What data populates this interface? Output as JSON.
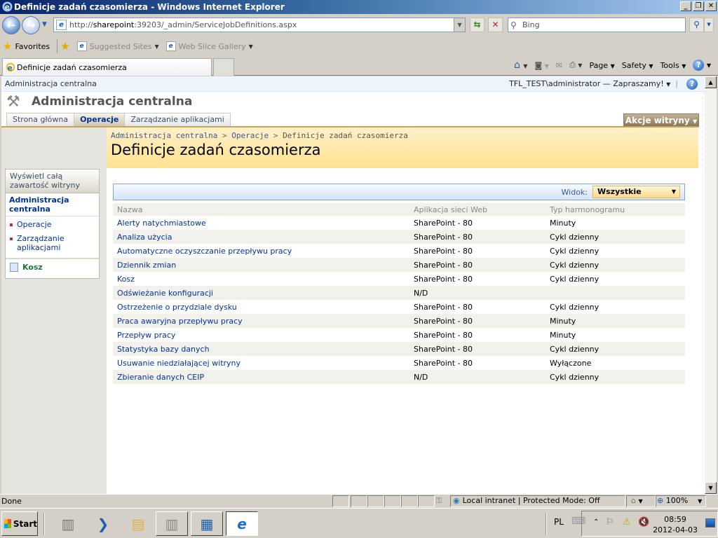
{
  "browser": {
    "window_title": "Definicje zadań czasomierza - Windows Internet Explorer",
    "address_url_prefix": "http://",
    "address_url_host": "sharepoint",
    "address_url_rest": ":39203/_admin/ServiceJobDefinitions.aspx",
    "search_placeholder": "Bing",
    "favorites_label": "Favorites",
    "favorites_links": [
      "Suggested Sites",
      "Web Slice Gallery"
    ],
    "tab_title": "Definicje zadań czasomierza",
    "commands": [
      "Page",
      "Safety",
      "Tools"
    ],
    "status_text": "Done",
    "zone_text": "Local intranet | Protected Mode: Off",
    "zoom_level": "100%"
  },
  "sharepoint": {
    "site_link": "Administracja centralna",
    "user_greeting": "TFL_TEST\\administrator — Zapraszamy!",
    "site_title": "Administracja centralna",
    "tabs": [
      {
        "label": "Strona główna",
        "active": false
      },
      {
        "label": "Operacje",
        "active": true
      },
      {
        "label": "Zarządzanie aplikacjami",
        "active": false
      }
    ],
    "site_actions_label": "Akcje witryny",
    "breadcrumb": [
      "Administracja centralna",
      "Operacje",
      "Definicje zadań czasomierza"
    ],
    "breadcrumb_separator": ">",
    "page_title": "Definicje zadań czasomierza",
    "leftnav": {
      "view_all": "Wyświetl całą zawartość witryny",
      "heading": "Administracja centralna",
      "items": [
        "Operacje",
        "Zarządzanie aplikacjami"
      ],
      "recycle_bin": "Kosz"
    },
    "view": {
      "label": "Widok:",
      "selected": "Wszystkie"
    },
    "table": {
      "columns": [
        "Nazwa",
        "Aplikacja sieci Web",
        "Typ harmonogramu"
      ],
      "rows": [
        [
          "Alerty natychmiastowe",
          "SharePoint - 80",
          "Minuty"
        ],
        [
          "Analiza użycia",
          "SharePoint - 80",
          "Cykl dzienny"
        ],
        [
          "Automatyczne oczyszczanie przepływu pracy",
          "SharePoint - 80",
          "Cykl dzienny"
        ],
        [
          "Dziennik zmian",
          "SharePoint - 80",
          "Cykl dzienny"
        ],
        [
          "Kosz",
          "SharePoint - 80",
          "Cykl dzienny"
        ],
        [
          "Odświeżanie konfiguracji",
          "N/D",
          ""
        ],
        [
          "Ostrzeżenie o przydziale dysku",
          "SharePoint - 80",
          "Cykl dzienny"
        ],
        [
          "Praca awaryjna przepływu pracy",
          "SharePoint - 80",
          "Minuty"
        ],
        [
          "Przepływ pracy",
          "SharePoint - 80",
          "Minuty"
        ],
        [
          "Statystyka bazy danych",
          "SharePoint - 80",
          "Cykl dzienny"
        ],
        [
          "Usuwanie niedziałającej witryny",
          "SharePoint - 80",
          "Wyłączone"
        ],
        [
          "Zbieranie danych CEIP",
          "N/D",
          "Cykl dzienny"
        ]
      ]
    }
  },
  "taskbar": {
    "start_label": "Start",
    "language": "PL",
    "time": "08:59",
    "date": "2012-04-03"
  }
}
